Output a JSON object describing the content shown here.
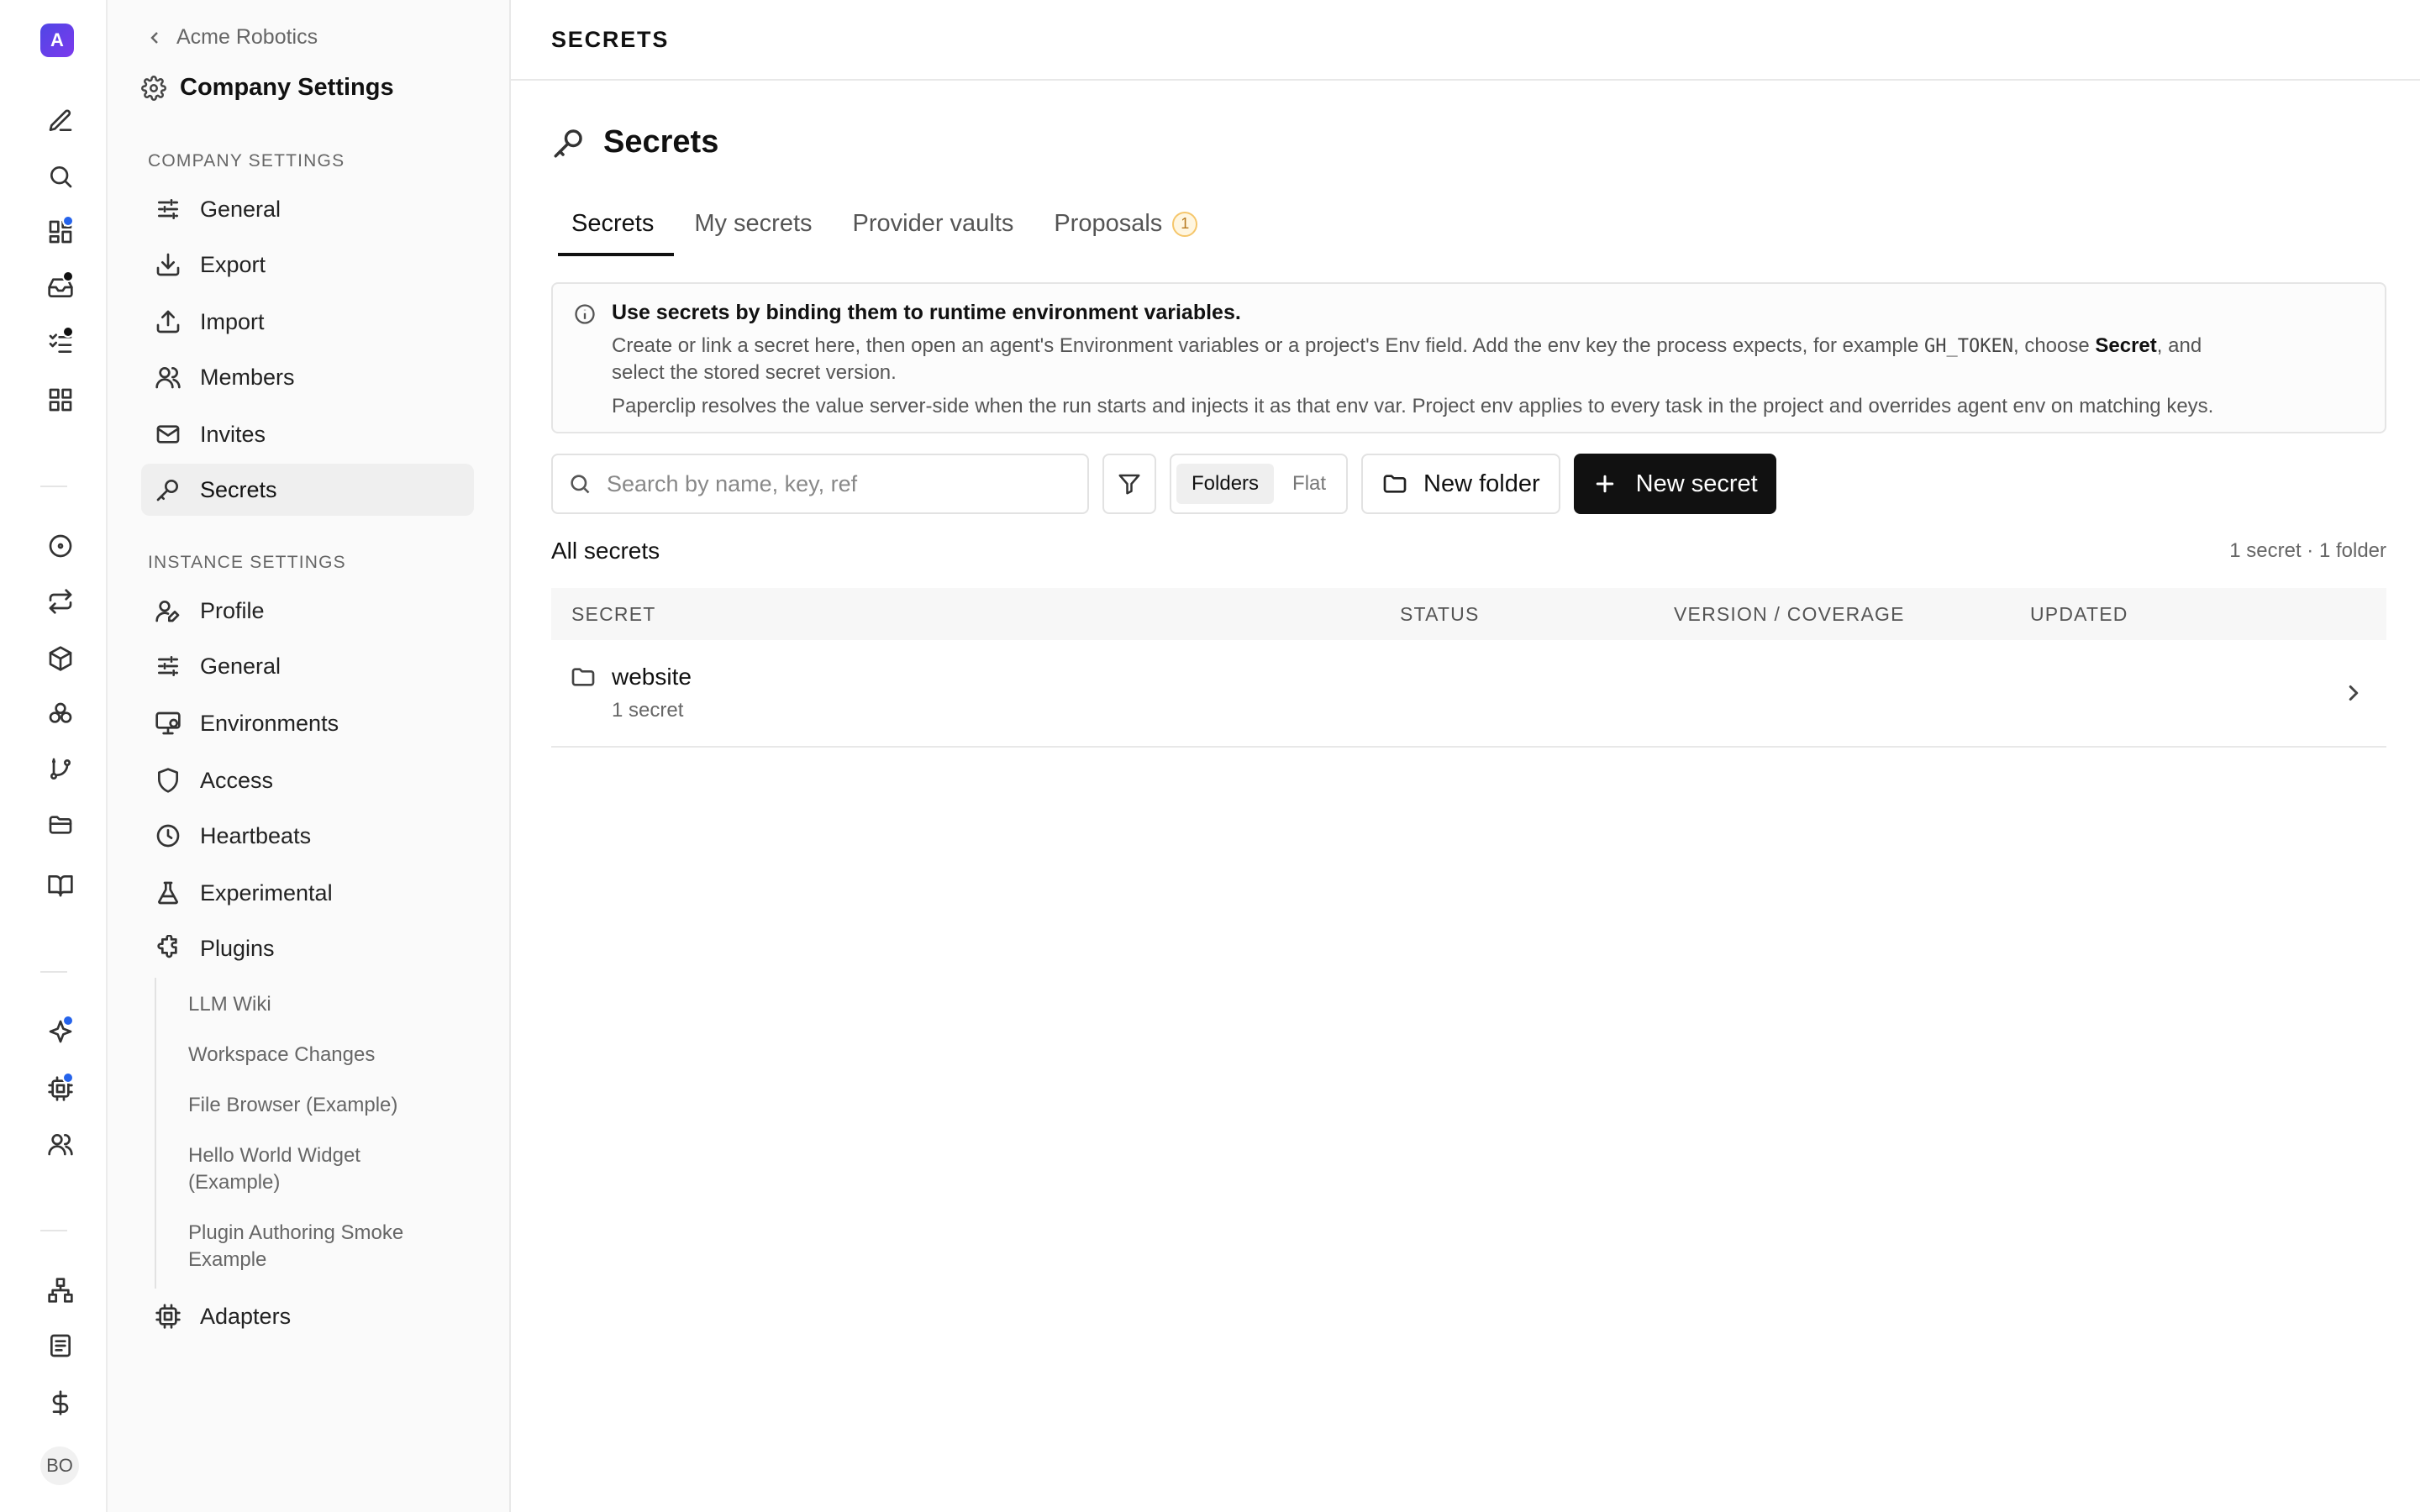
{
  "rail": {
    "company_initial": "A",
    "user_initials": "BO",
    "icons": [
      "edit-icon",
      "search-icon",
      "dashboard-icon",
      "inbox-icon",
      "tasks-icon",
      "apps-grid-icon",
      "target-icon",
      "sync-icon",
      "package-icon",
      "cluster-icon",
      "git-branch-icon",
      "folder-icon",
      "book-icon",
      "sparkle-icon",
      "cpu-icon",
      "users-icon",
      "org-chart-icon",
      "document-icon",
      "dollar-icon"
    ]
  },
  "sidebar": {
    "back_label": "Acme Robotics",
    "title": "Company Settings",
    "company_section": "COMPANY SETTINGS",
    "company_items": [
      {
        "label": "General",
        "icon": "sliders-icon"
      },
      {
        "label": "Export",
        "icon": "download-icon"
      },
      {
        "label": "Import",
        "icon": "upload-icon"
      },
      {
        "label": "Members",
        "icon": "users-icon"
      },
      {
        "label": "Invites",
        "icon": "mail-icon"
      },
      {
        "label": "Secrets",
        "icon": "key-icon",
        "active": true
      }
    ],
    "instance_section": "INSTANCE SETTINGS",
    "instance_items": [
      {
        "label": "Profile",
        "icon": "user-pen-icon"
      },
      {
        "label": "General",
        "icon": "sliders-icon"
      },
      {
        "label": "Environments",
        "icon": "monitor-icon"
      },
      {
        "label": "Access",
        "icon": "shield-icon"
      },
      {
        "label": "Heartbeats",
        "icon": "clock-icon"
      },
      {
        "label": "Experimental",
        "icon": "flask-icon"
      },
      {
        "label": "Plugins",
        "icon": "puzzle-icon"
      }
    ],
    "plugins": [
      "LLM Wiki",
      "Workspace Changes",
      "File Browser (Example)",
      "Hello World Widget (Example)",
      "Plugin Authoring Smoke Example"
    ],
    "adapters_label": "Adapters"
  },
  "main": {
    "breadcrumb": "SECRETS",
    "title": "Secrets",
    "tabs": [
      {
        "label": "Secrets",
        "active": true
      },
      {
        "label": "My secrets"
      },
      {
        "label": "Provider vaults"
      },
      {
        "label": "Proposals",
        "badge": "1"
      }
    ],
    "info": {
      "title": "Use secrets by binding them to runtime environment variables.",
      "line1_a": "Create or link a secret here, then open an agent's Environment variables or a project's Env field. Add the env key the process expects, for example ",
      "line1_code": "GH_TOKEN",
      "line1_b": ", choose ",
      "line1_bold": "Secret",
      "line1_c": ", and",
      "line2": "select the stored secret version.",
      "line3": "Paperclip resolves the value server-side when the run starts and injects it as that env var. Project env applies to every task in the project and overrides agent env on matching keys."
    },
    "search_placeholder": "Search by name, key, ref",
    "view_modes": [
      "Folders",
      "Flat"
    ],
    "new_folder_label": "New folder",
    "new_secret_label": "New secret",
    "list_title": "All secrets",
    "list_count": "1 secret · 1 folder",
    "columns": [
      "SECRET",
      "STATUS",
      "VERSION / COVERAGE",
      "UPDATED"
    ],
    "rows": [
      {
        "name": "website",
        "sub": "1 secret"
      }
    ]
  }
}
